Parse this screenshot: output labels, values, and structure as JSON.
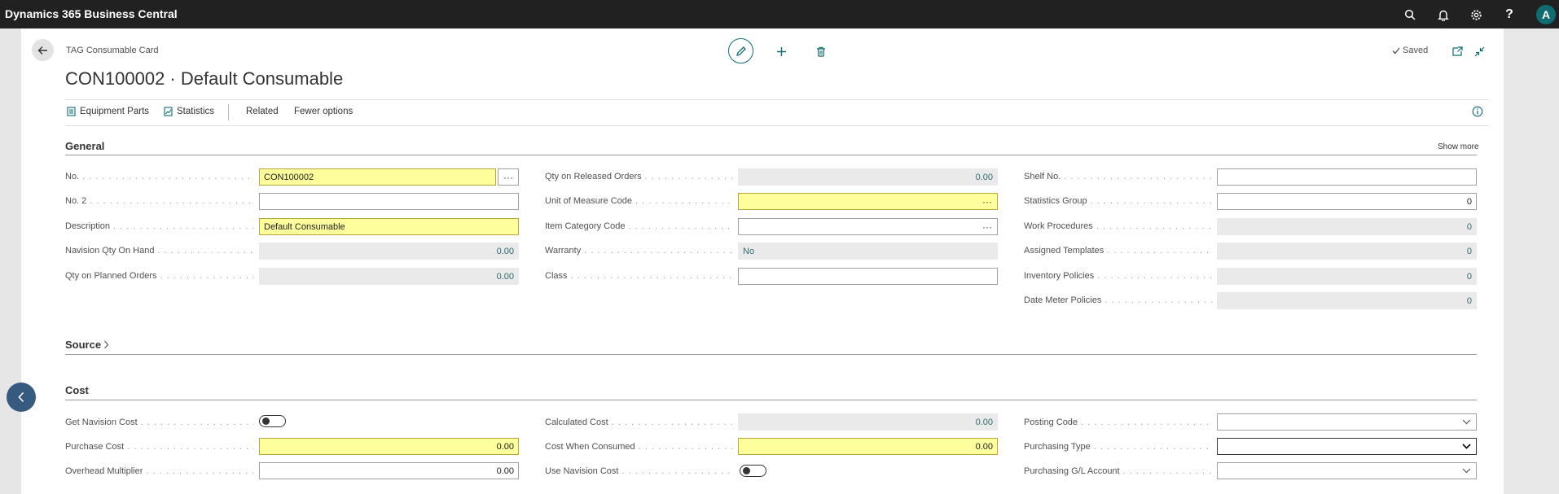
{
  "app": {
    "title": "Dynamics 365 Business Central",
    "avatar_initial": "A"
  },
  "topbar_icons": [
    "search-icon",
    "bell-icon",
    "gear-icon",
    "help-icon"
  ],
  "header": {
    "caption": "TAG Consumable Card",
    "title": "CON100002 · Default Consumable",
    "saved_label": "Saved"
  },
  "actions": {
    "equipment_parts": "Equipment Parts",
    "statistics": "Statistics",
    "related": "Related",
    "fewer_options": "Fewer options"
  },
  "general": {
    "title": "General",
    "show_more": "Show more",
    "col1": [
      {
        "label": "No.",
        "value": "CON100002"
      },
      {
        "label": "No. 2",
        "value": ""
      },
      {
        "label": "Description",
        "value": "Default Consumable"
      },
      {
        "label": "Navision Qty On Hand",
        "value": "0.00"
      },
      {
        "label": "Qty on Planned Orders",
        "value": "0.00"
      }
    ],
    "col2": [
      {
        "label": "Qty on Released Orders",
        "value": "0.00"
      },
      {
        "label": "Unit of Measure Code",
        "value": ""
      },
      {
        "label": "Item Category Code",
        "value": ""
      },
      {
        "label": "Warranty",
        "value": "No"
      },
      {
        "label": "Class",
        "value": ""
      }
    ],
    "col3": [
      {
        "label": "Shelf No.",
        "value": ""
      },
      {
        "label": "Statistics Group",
        "value": "0"
      },
      {
        "label": "Work Procedures",
        "value": "0"
      },
      {
        "label": "Assigned Templates",
        "value": "0"
      },
      {
        "label": "Inventory Policies",
        "value": "0"
      },
      {
        "label": "Date Meter Policies",
        "value": "0"
      }
    ]
  },
  "source": {
    "title": "Source"
  },
  "cost": {
    "title": "Cost",
    "col1": [
      {
        "label": "Get Navision Cost",
        "value": ""
      },
      {
        "label": "Purchase Cost",
        "value": "0.00"
      },
      {
        "label": "Overhead Multiplier",
        "value": "0.00"
      }
    ],
    "col2": [
      {
        "label": "Calculated Cost",
        "value": "0.00"
      },
      {
        "label": "Cost When Consumed",
        "value": "0.00"
      },
      {
        "label": "Use Navision Cost",
        "value": ""
      }
    ],
    "col3": [
      {
        "label": "Posting Code",
        "value": ""
      },
      {
        "label": "Purchasing Type",
        "value": ""
      },
      {
        "label": "Purchasing G/L Account",
        "value": ""
      }
    ]
  }
}
